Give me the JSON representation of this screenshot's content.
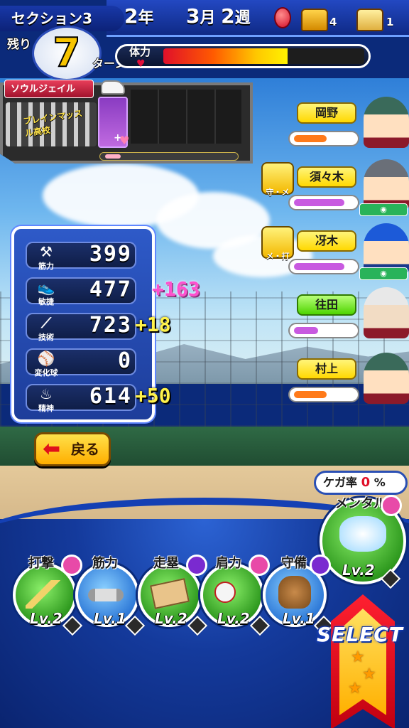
{
  "header": {
    "section_label": "セクション3",
    "remaining_label": "残り",
    "turns_left": "7",
    "turn_unit": "ターン",
    "year_num": "2",
    "year_unit": "年",
    "month_num": "3",
    "month_unit": "月",
    "week_num": "2",
    "week_unit": "週",
    "mood_icon": "mood-face-red",
    "chest_gold_count": "4",
    "chest_silver_count": "1",
    "stamina_label": "体力",
    "stamina_fraction": 0.62
  },
  "soul": {
    "tag": "ソウルジェイル",
    "school_logo": "ブレインマッスル高校",
    "card_plus": "+",
    "progress_fraction": 0.12
  },
  "stats": [
    {
      "label": "筋力",
      "icon": "dumbbell-icon",
      "value": "399",
      "bonus": ""
    },
    {
      "label": "敏捷",
      "icon": "cleat-icon",
      "value": "477",
      "bonus": "+163"
    },
    {
      "label": "技術",
      "icon": "bat-icon",
      "value": "723",
      "bonus": "+18"
    },
    {
      "label": "変化球",
      "icon": "baseball-icon",
      "value": "0",
      "bonus": ""
    },
    {
      "label": "精神",
      "icon": "spirit-icon",
      "value": "614",
      "bonus": "+50"
    }
  ],
  "back_button": {
    "label": "戻る"
  },
  "teammates": [
    {
      "name": "岡野",
      "bar_color": "#ff7a1a",
      "bar_fraction": 0.55,
      "badge": "",
      "bond": false
    },
    {
      "name": "須々木",
      "bar_color": "#c85ae0",
      "bar_fraction": 0.85,
      "badge": "守・メ",
      "bond": true
    },
    {
      "name": "冴木",
      "bar_color": "#c85ae0",
      "bar_fraction": 0.85,
      "badge": "メ・打",
      "bond": true
    },
    {
      "name": "往田",
      "bar_color": "#c85ae0",
      "bar_fraction": 0.4,
      "badge": "",
      "bond": false
    },
    {
      "name": "村上",
      "bar_color": "#ff7a1a",
      "bar_fraction": 0.55,
      "badge": "",
      "bond": false
    }
  ],
  "injury": {
    "label": "ケガ率",
    "value": "0",
    "unit": "%"
  },
  "practices": [
    {
      "title": "打撃",
      "level": "Lv.2"
    },
    {
      "title": "筋力",
      "level": "Lv.1"
    },
    {
      "title": "走塁",
      "level": "Lv.2"
    },
    {
      "title": "肩力",
      "level": "Lv.2"
    },
    {
      "title": "守備",
      "level": "Lv.1"
    }
  ],
  "mental": {
    "title": "メンタル",
    "level": "Lv.2"
  },
  "select": {
    "label": "SELECT"
  }
}
